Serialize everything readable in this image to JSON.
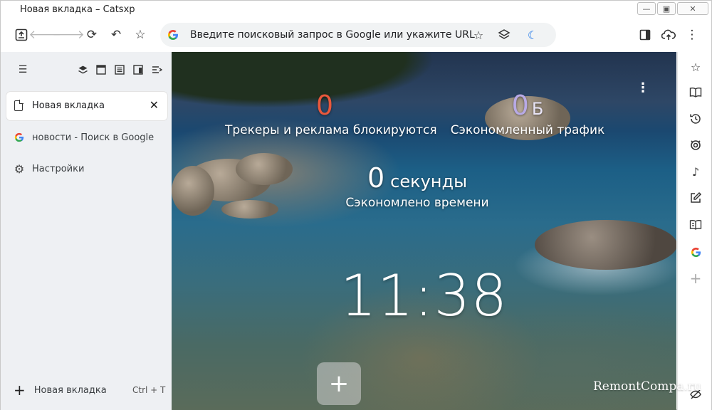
{
  "window": {
    "title": "Новая вкладка – Catsxp"
  },
  "omnibox": {
    "placeholder": "Введите поисковый запрос в Google или укажите URL"
  },
  "sidebar": {
    "active_tab": {
      "label": "Новая вкладка"
    },
    "items": [
      {
        "label": "новости - Поиск в Google"
      },
      {
        "label": "Настройки"
      }
    ],
    "new_tab": {
      "label": "Новая вкладка",
      "shortcut": "Ctrl + T"
    }
  },
  "stats": {
    "trackers": {
      "value": "0",
      "label": "Трекеры и реклама блокируются",
      "color": "#e8583c"
    },
    "traffic": {
      "value": "0",
      "unit": "Б",
      "label": "Сэкономленный трафик",
      "color": "#b8aae6"
    },
    "time": {
      "value": "0",
      "unit": "секунды",
      "label": "Сэкономлено времени"
    }
  },
  "clock": "11:38",
  "watermark": "RemontCompa.ru",
  "colors": {
    "accent_blue": "#1a73e8",
    "moon": "#1a73e8"
  }
}
